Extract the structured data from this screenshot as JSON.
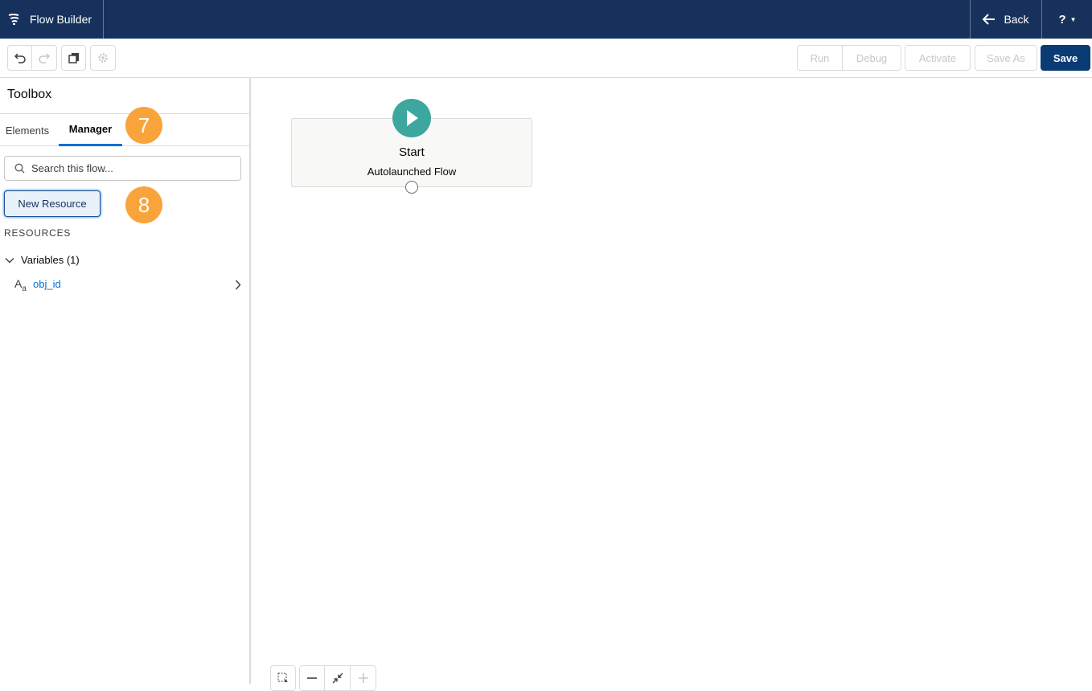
{
  "header": {
    "app_title": "Flow Builder",
    "back_label": "Back",
    "help_label": "?"
  },
  "toolbar": {
    "run_label": "Run",
    "debug_label": "Debug",
    "activate_label": "Activate",
    "save_as_label": "Save As",
    "save_label": "Save"
  },
  "sidebar": {
    "title": "Toolbox",
    "tabs": [
      {
        "label": "Elements",
        "active": false
      },
      {
        "label": "Manager",
        "active": true
      }
    ],
    "search_placeholder": "Search this flow...",
    "new_resource_label": "New Resource",
    "resources_heading": "RESOURCES",
    "variables_group": "Variables (1)",
    "variables": [
      {
        "type_icon": "text-type-icon",
        "name": "obj_id"
      }
    ]
  },
  "callouts": {
    "badge_1": "7",
    "badge_2": "8"
  },
  "canvas": {
    "start_label": "Start",
    "start_subtitle": "Autolaunched Flow"
  },
  "colors": {
    "header_bg": "#16325c",
    "save_bg": "#0b3b74",
    "accent": "#0070d2",
    "start_icon": "#3ba79e",
    "badge": "#f9a43b"
  }
}
